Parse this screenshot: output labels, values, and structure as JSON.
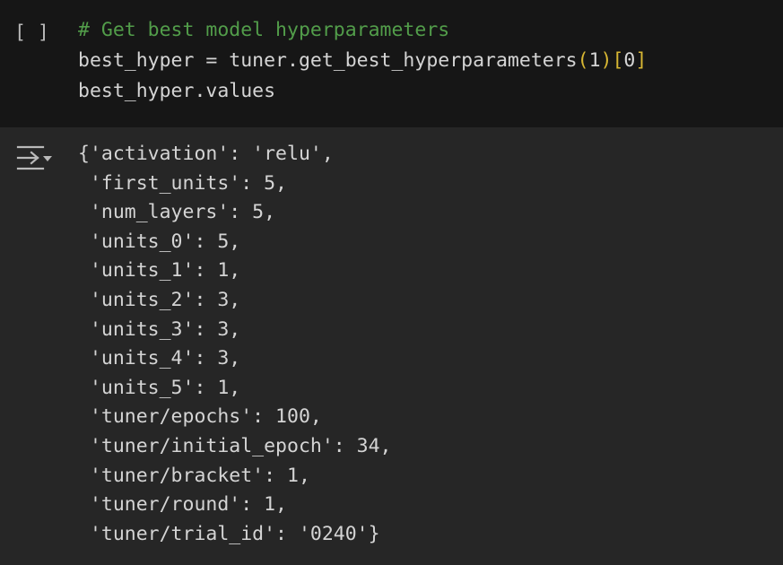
{
  "code_cell": {
    "run_indicator": "[ ]",
    "comment": "# Get best model hyperparameters",
    "line2": {
      "prefix": "best_hyper = tuner.get_best_hyperparameters",
      "open_paren": "(",
      "arg": "1",
      "close_paren": ")",
      "open_bracket": "[",
      "index": "0",
      "close_bracket": "]"
    },
    "line3": "best_hyper.values"
  },
  "output": {
    "icon": "output-toggle-icon",
    "lines": [
      "{'activation': 'relu',",
      " 'first_units': 5,",
      " 'num_layers': 5,",
      " 'units_0': 5,",
      " 'units_1': 1,",
      " 'units_2': 3,",
      " 'units_3': 3,",
      " 'units_4': 3,",
      " 'units_5': 1,",
      " 'tuner/epochs': 100,",
      " 'tuner/initial_epoch': 34,",
      " 'tuner/bracket': 1,",
      " 'tuner/round': 1,",
      " 'tuner/trial_id': '0240'}"
    ]
  },
  "colors": {
    "code_background": "#161616",
    "output_background": "#262626",
    "comment": "#529d4a",
    "text": "#d4d4d4",
    "bracket_highlight": "#d8b733"
  }
}
